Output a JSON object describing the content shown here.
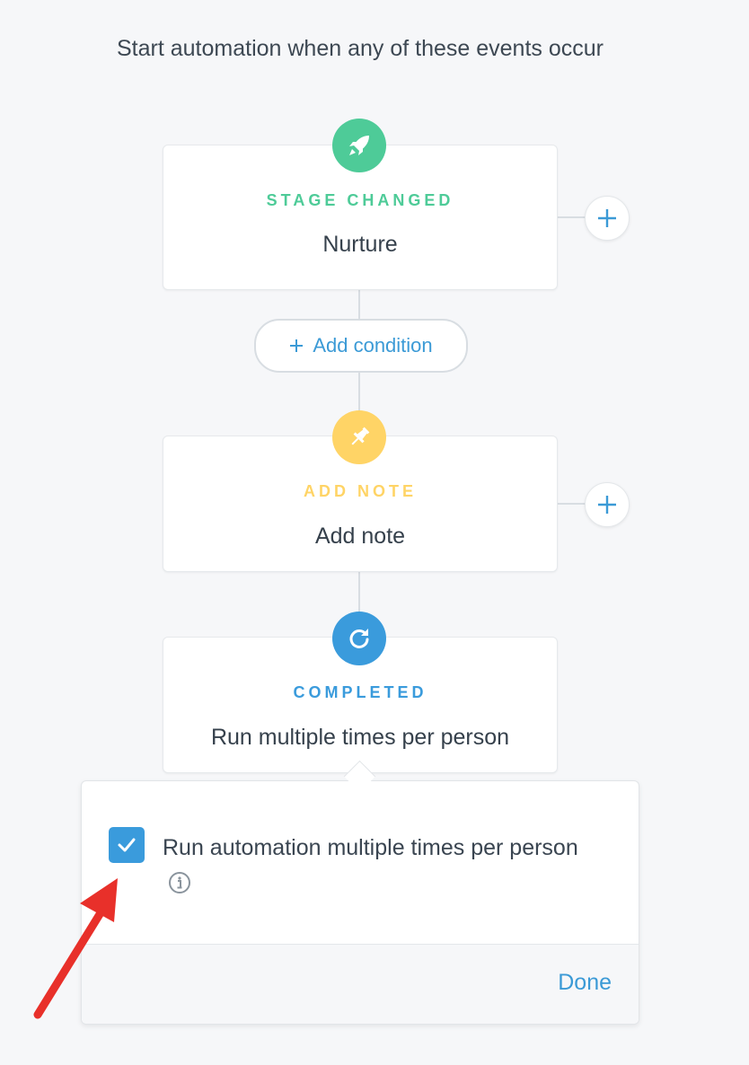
{
  "header": {
    "title": "Start automation when any of these events occur"
  },
  "steps": [
    {
      "type_label": "STAGE CHANGED",
      "value": "Nurture",
      "icon": "rocket-icon",
      "color": "#4ecb98"
    },
    {
      "type_label": "ADD NOTE",
      "value": "Add note",
      "icon": "pushpin-icon",
      "color": "#ffd466"
    },
    {
      "type_label": "COMPLETED",
      "value": "Run multiple times per person",
      "icon": "refresh-icon",
      "color": "#3a9bdc"
    }
  ],
  "add_condition": {
    "label": "Add condition",
    "icon": "plus-icon"
  },
  "popover": {
    "checkbox_checked": true,
    "checkbox_label": "Run automation multiple times per person",
    "info_icon": "info-icon",
    "done_label": "Done"
  },
  "colors": {
    "accent": "#3b9ad6",
    "annotation_arrow": "#e8302a"
  }
}
